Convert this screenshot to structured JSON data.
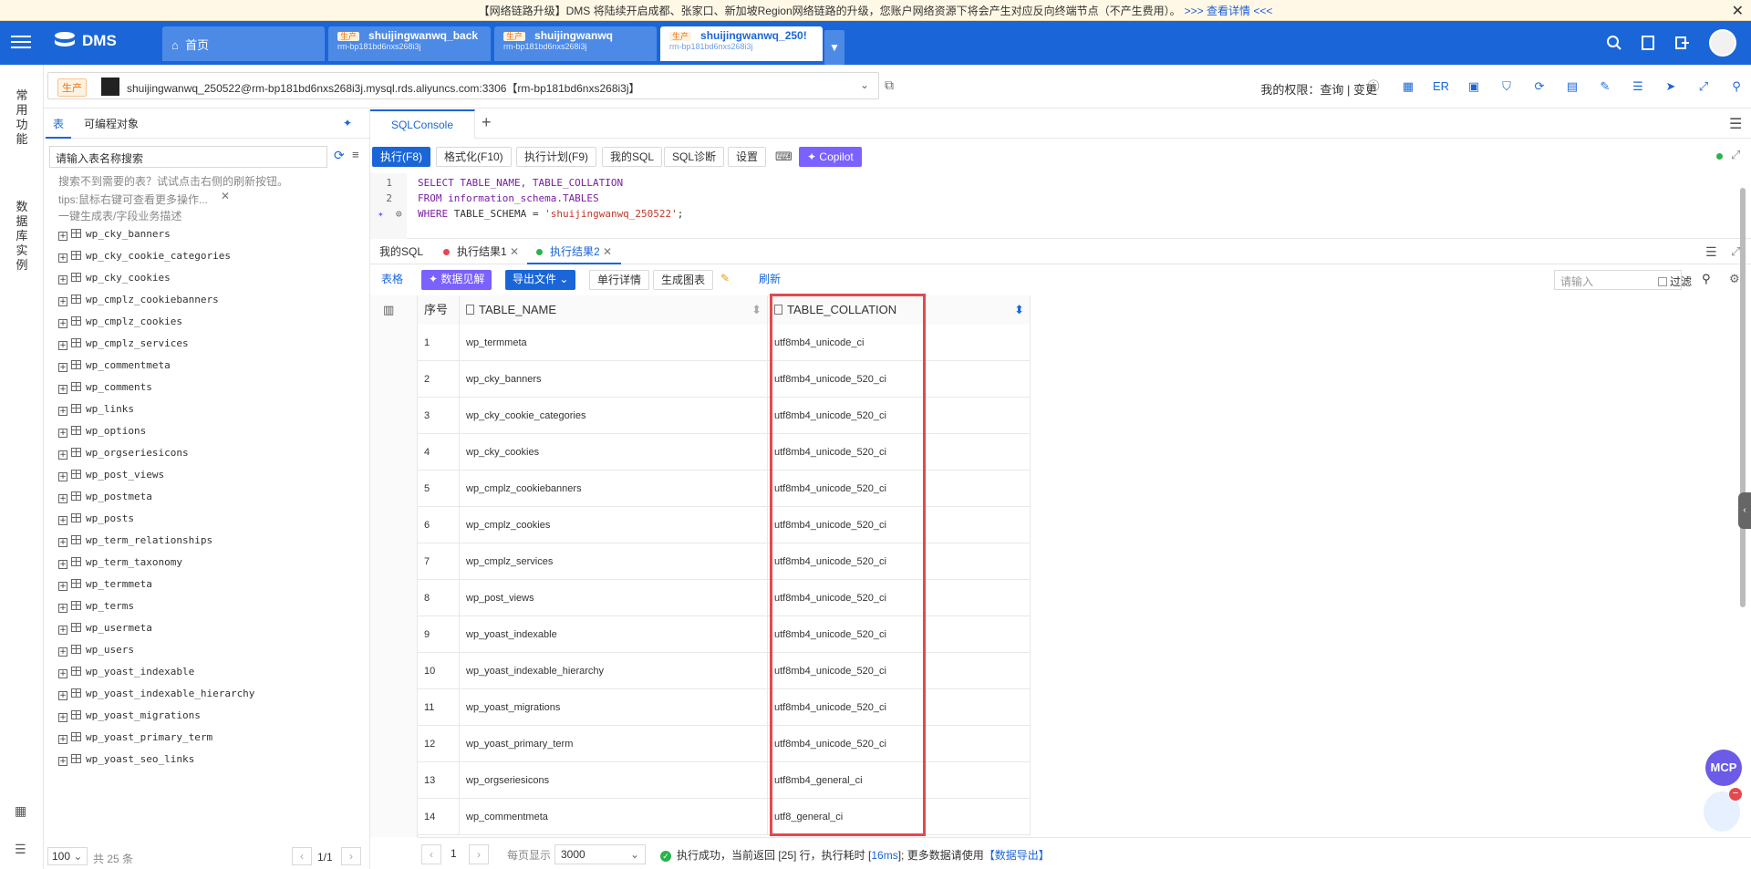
{
  "announcement": {
    "text": "【网络链路升级】DMS 将陆续开启成都、张家口、新加坡Region网络链路的升级，您账户网络资源下将会产生对应反向终端节点（不产生费用）。",
    "link": ">>> 查看详情 <<<"
  },
  "topbar": {
    "brand": "DMS",
    "home_tab": "首页",
    "tabs": [
      {
        "badge": "生产",
        "title": "shuijingwanwq_back",
        "sub": "rm-bp181bd6nxs268i3j"
      },
      {
        "badge": "生产",
        "title": "shuijingwanwq",
        "sub": "rm-bp181bd6nxs268i3j"
      },
      {
        "badge": "生产",
        "title": "shuijingwanwq_250!",
        "sub": "rm-bp181bd6nxs268i3j"
      }
    ]
  },
  "leftnav": {
    "common": "常用功能",
    "instances": "数据库实例"
  },
  "connection": {
    "env": "生产",
    "text": "shuijingwanwq_250522@rm-bp181bd6nxs268i3j.mysql.rds.aliyuncs.com:3306【rm-bp181bd6nxs268i3j】",
    "permissions": "我的权限：查询 | 变更",
    "tool_er": "ER"
  },
  "leftpanel": {
    "tab_tables": "表",
    "tab_programmable": "可编程对象",
    "search_placeholder": "请输入表名称搜索",
    "hint1": "搜索不到需要的表？试试点击右侧的刷新按钮。",
    "hint2": "tips:鼠标右键可查看更多操作...",
    "hint3": "一键生成表/字段业务描述",
    "tables": [
      "wp_cky_banners",
      "wp_cky_cookie_categories",
      "wp_cky_cookies",
      "wp_cmplz_cookiebanners",
      "wp_cmplz_cookies",
      "wp_cmplz_services",
      "wp_commentmeta",
      "wp_comments",
      "wp_links",
      "wp_options",
      "wp_orgseriesicons",
      "wp_post_views",
      "wp_postmeta",
      "wp_posts",
      "wp_term_relationships",
      "wp_term_taxonomy",
      "wp_termmeta",
      "wp_terms",
      "wp_usermeta",
      "wp_users",
      "wp_yoast_indexable",
      "wp_yoast_indexable_hierarchy",
      "wp_yoast_migrations",
      "wp_yoast_primary_term",
      "wp_yoast_seo_links"
    ],
    "page_size": "100",
    "total": "共 25 条",
    "page": "1/1"
  },
  "editor": {
    "tab": "SQLConsole",
    "toolbar": {
      "run": "执行(F8)",
      "format": "格式化(F10)",
      "plan": "执行计划(F9)",
      "my_sql": "我的SQL",
      "diagnose": "SQL诊断",
      "settings": "设置",
      "copilot": "Copilot"
    },
    "lines": [
      {
        "num": "1",
        "a": "SELECT TABLE_NAME, TABLE_COLLATION"
      },
      {
        "num": "2",
        "a": "FROM information_schema.TABLES"
      },
      {
        "num": "3",
        "kw": "WHERE",
        "a": " TABLE_SCHEMA = ",
        "str": "'shuijingwanwq_250522'",
        "end": ";"
      }
    ]
  },
  "results": {
    "tabs": [
      "我的SQL",
      "执行结果1",
      "执行结果2"
    ],
    "toolbar": {
      "grid": "表格",
      "insight": "数据见解",
      "export": "导出文件",
      "row_detail": "单行详情",
      "chart": "生成图表",
      "refresh": "刷新",
      "filter_placeholder": "请输入",
      "filter": "过滤"
    },
    "columns": [
      "序号",
      "TABLE_NAME",
      "TABLE_COLLATION"
    ],
    "rows": [
      [
        "1",
        "wp_termmeta",
        "utf8mb4_unicode_ci"
      ],
      [
        "2",
        "wp_cky_banners",
        "utf8mb4_unicode_520_ci"
      ],
      [
        "3",
        "wp_cky_cookie_categories",
        "utf8mb4_unicode_520_ci"
      ],
      [
        "4",
        "wp_cky_cookies",
        "utf8mb4_unicode_520_ci"
      ],
      [
        "5",
        "wp_cmplz_cookiebanners",
        "utf8mb4_unicode_520_ci"
      ],
      [
        "6",
        "wp_cmplz_cookies",
        "utf8mb4_unicode_520_ci"
      ],
      [
        "7",
        "wp_cmplz_services",
        "utf8mb4_unicode_520_ci"
      ],
      [
        "8",
        "wp_post_views",
        "utf8mb4_unicode_520_ci"
      ],
      [
        "9",
        "wp_yoast_indexable",
        "utf8mb4_unicode_520_ci"
      ],
      [
        "10",
        "wp_yoast_indexable_hierarchy",
        "utf8mb4_unicode_520_ci"
      ],
      [
        "11",
        "wp_yoast_migrations",
        "utf8mb4_unicode_520_ci"
      ],
      [
        "12",
        "wp_yoast_primary_term",
        "utf8mb4_unicode_520_ci"
      ],
      [
        "13",
        "wp_orgseriesicons",
        "utf8mb4_general_ci"
      ],
      [
        "14",
        "wp_commentmeta",
        "utf8_general_ci"
      ]
    ],
    "status": {
      "page": "1",
      "per_page_label": "每页显示",
      "per_page": "3000",
      "msg1": "执行成功，当前返回 [25] 行，执行耗时 [",
      "time": "16ms",
      "msg2": "]; 更多数据请使用",
      "export": "【数据导出】"
    }
  },
  "widgets": {
    "mcp": "MCP"
  },
  "colors": {
    "primary": "#1a66d9",
    "highlight": "#e5484d",
    "copilot": "#7b61ff"
  }
}
